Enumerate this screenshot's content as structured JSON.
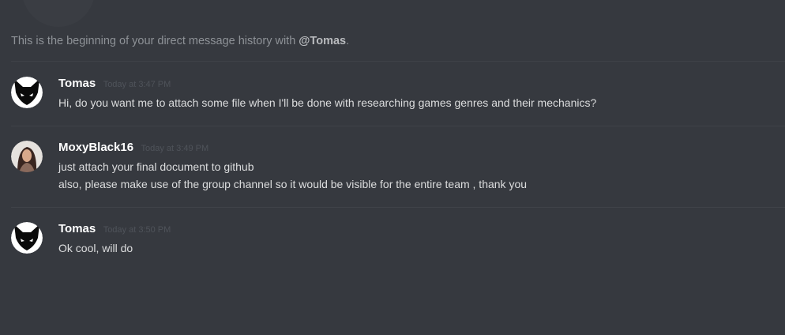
{
  "intro": {
    "prefix": "This is the beginning of your direct message history with ",
    "mention": "@Tomas",
    "suffix": "."
  },
  "messages": [
    {
      "author": "Tomas",
      "timestamp": "Today at 3:47 PM",
      "avatar_icon": "fox-silhouette-icon",
      "lines": [
        "Hi, do you want me to attach some file when I'll be done with researching games genres and their mechanics?"
      ]
    },
    {
      "author": "MoxyBlack16",
      "timestamp": "Today at 3:49 PM",
      "avatar_icon": "profile-photo-avatar",
      "lines": [
        "just attach your final document to github",
        "also, please make use of the group channel so it would be visible for the entire team , thank you"
      ]
    },
    {
      "author": "Tomas",
      "timestamp": "Today at 3:50 PM",
      "avatar_icon": "fox-silhouette-icon",
      "lines": [
        "Ok cool, will do"
      ]
    }
  ],
  "colors": {
    "background": "#36393f",
    "username": "#ffffff",
    "message_text": "#dcddde",
    "timestamp": "#4f535a",
    "intro_text": "#8e9297"
  }
}
